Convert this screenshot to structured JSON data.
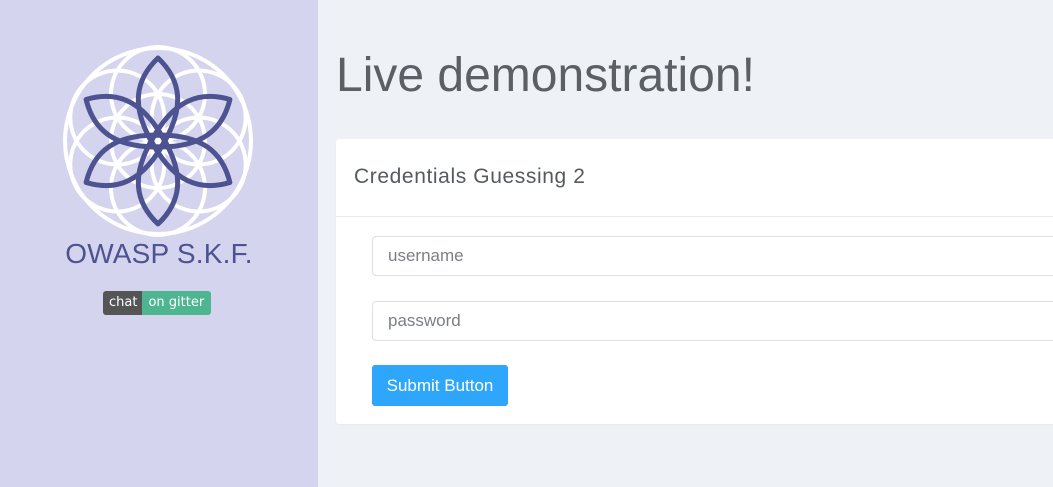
{
  "sidebar": {
    "logo_icon": "flower-of-life-logo",
    "brand": "OWASP S.K.F.",
    "badge": {
      "left": "chat",
      "right": "on gitter",
      "left_color": "#555555",
      "right_color": "#4db58f"
    },
    "background": "#d4d4ee",
    "accent": "#4d5290"
  },
  "main": {
    "title": "Live demonstration!",
    "card": {
      "title": "Credentials Guessing 2",
      "username": {
        "placeholder": "username",
        "value": ""
      },
      "password": {
        "placeholder": "password",
        "value": ""
      },
      "submit_label": "Submit Button",
      "submit_color": "#2ea6fb"
    }
  }
}
